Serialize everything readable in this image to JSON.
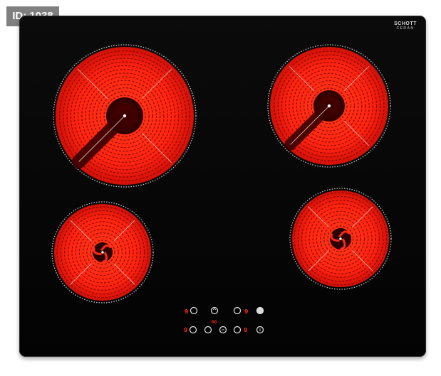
{
  "id_label": "ID: 1038",
  "brand": {
    "line1": "SCHOTT",
    "line2": "CERAN"
  },
  "colors": {
    "glass": "#050505",
    "coil": "#ff1a0a",
    "coil_dark": "#6a0000",
    "control_red": "#ff2a1a",
    "control_white": "#e6e6e6"
  },
  "burners": [
    {
      "name": "rear-left-burner",
      "coil_style": "spiral-with-stripe"
    },
    {
      "name": "rear-right-burner",
      "coil_style": "spiral-with-stripe"
    },
    {
      "name": "front-left-burner",
      "coil_style": "swirl"
    },
    {
      "name": "front-right-burner",
      "coil_style": "swirl"
    }
  ],
  "control_panel": {
    "top_row": [
      "button",
      "9-digit",
      "button",
      "button",
      "9-digit",
      "button"
    ],
    "bottom_row": [
      "9-digit",
      "button",
      "button",
      "button",
      "button",
      "9-digit",
      "button"
    ],
    "center_indicator": "00"
  }
}
